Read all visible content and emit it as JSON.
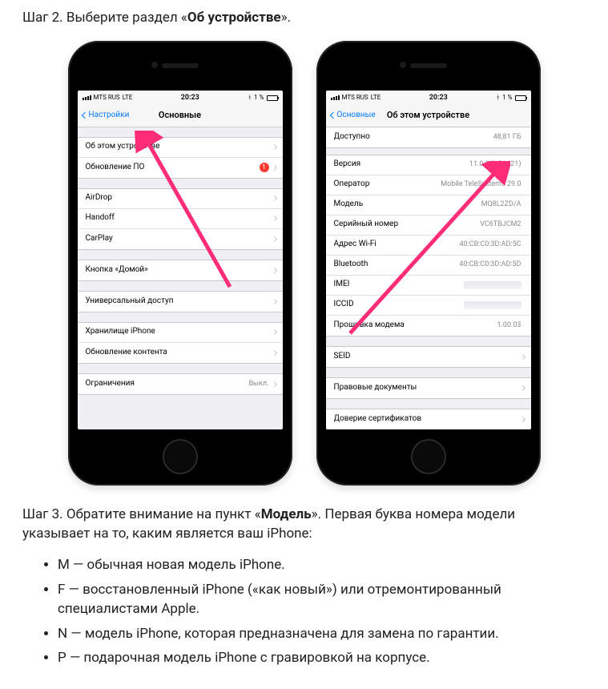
{
  "step2": {
    "prefix": "Шаг 2. Выберите раздел «",
    "bold": "Об устройстве",
    "suffix": "»."
  },
  "status": {
    "carrier": "MTS RUS",
    "network": "LTE",
    "time": "20:23",
    "bt_glyph": "⚡",
    "battery": "1 %",
    "battery_icon_glyph": "▢"
  },
  "phone1": {
    "nav_back": "Настройки",
    "nav_title": "Основные",
    "g1": [
      {
        "label": "Об этом устройстве",
        "chev": true
      },
      {
        "label": "Обновление ПО",
        "badge": "1",
        "chev": true
      }
    ],
    "g2": [
      {
        "label": "AirDrop",
        "chev": true
      },
      {
        "label": "Handoff",
        "chev": true
      },
      {
        "label": "CarPlay",
        "chev": true
      }
    ],
    "g3": [
      {
        "label": "Кнопка «Домой»",
        "chev": true
      }
    ],
    "g4": [
      {
        "label": "Универсальный доступ",
        "chev": true
      }
    ],
    "g5": [
      {
        "label": "Хранилище iPhone",
        "chev": true
      },
      {
        "label": "Обновление контента",
        "chev": true
      }
    ],
    "g6": [
      {
        "label": "Ограничения",
        "value": "Выкл.",
        "chev": true
      }
    ]
  },
  "phone2": {
    "nav_back": "Основные",
    "nav_title": "Об этом устройстве",
    "g0": [
      {
        "label": "Доступно",
        "value": "48,81 ГБ"
      }
    ],
    "g1": [
      {
        "label": "Версия",
        "value": "11.0.2 (15A421)"
      },
      {
        "label": "Оператор",
        "value": "Mobile TeleSystems 29.0"
      },
      {
        "label": "Модель",
        "value": "MQ8L2ZD/A"
      },
      {
        "label": "Серийный номер",
        "value": "VC6TBJCM2"
      },
      {
        "label": "Адрес Wi-Fi",
        "value": "40:CB:C0:3D:AD:5C"
      },
      {
        "label": "Bluetooth",
        "value": "40:CB:C0:3D:AD:5D"
      },
      {
        "label": "IMEI",
        "blur": true
      },
      {
        "label": "ICCID",
        "blur": true
      },
      {
        "label": "Прошивка модема",
        "value": "1.00.03"
      }
    ],
    "g2": [
      {
        "label": "SEID",
        "chev": true
      }
    ],
    "g3": [
      {
        "label": "Правовые документы",
        "chev": true
      }
    ],
    "g4": [
      {
        "label": "Доверие сертификатов",
        "chev": true
      }
    ]
  },
  "step3": {
    "prefix": "Шаг 3. Обратите внимание на пункт «",
    "bold": "Модель",
    "suffix": "». Первая буква номера модели указывает на то, каким является ваш iPhone:"
  },
  "legend": [
    "M — обычная новая модель iPhone.",
    "F — восстановленный iPhone («как новый») или отремонтированный специалистами Apple.",
    "N — модель iPhone, которая предназначена для замена по гарантии.",
    "P — подарочная модель iPhone с гравировкой на корпусе."
  ]
}
